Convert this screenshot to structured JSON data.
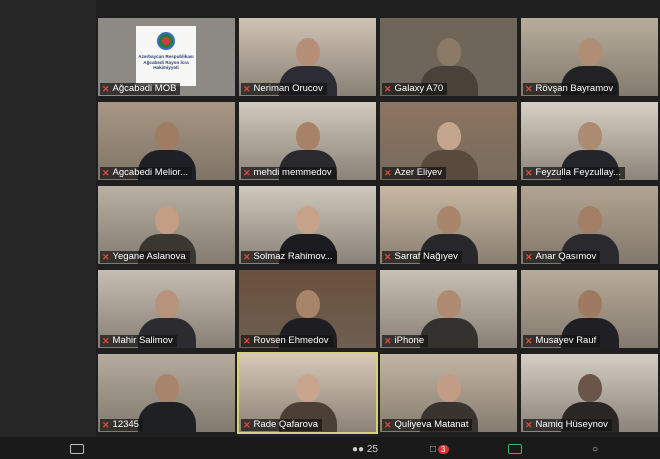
{
  "meeting": {
    "participant_count": "25",
    "toolbar_badge": "3",
    "participants": [
      {
        "name": "Ağcabədi MOB",
        "variant": "logo",
        "logo_text": "Azərbaycan Respublikası Ağcabədi Rayon İcra Hakimiyyəti"
      },
      {
        "name": "Neriman Orucov",
        "bg": "#cfc3b4",
        "skin": "#b58f78",
        "cloth": "#2c2c34"
      },
      {
        "name": "Galaxy A70",
        "bg": "#6f6659",
        "skin": "#8d7a66",
        "cloth": "#4a4238"
      },
      {
        "name": "Rövşan Bayramov",
        "bg": "#b8ad9c",
        "skin": "#b08e76",
        "cloth": "#232326"
      },
      {
        "name": "Agcabedi Melior...",
        "bg": "#a89784",
        "skin": "#9f7c62",
        "cloth": "#1f2026"
      },
      {
        "name": "mehdi memmedov",
        "bg": "#d2cabc",
        "skin": "#a88268",
        "cloth": "#2a2a2e"
      },
      {
        "name": "Azer Eliyev",
        "bg": "#8d7560",
        "skin": "#c4a58e",
        "cloth": "#5a4a3e"
      },
      {
        "name": "Feyzulla Feyzullay...",
        "bg": "#d8d0c4",
        "skin": "#ad8a72",
        "cloth": "#24252b"
      },
      {
        "name": "Yegane Aslanova",
        "bg": "#b9b0a3",
        "skin": "#c39d84",
        "cloth": "#3a3630"
      },
      {
        "name": "Solmaz Rahimov...",
        "bg": "#cfc8bd",
        "skin": "#c7a28a",
        "cloth": "#1c1c20"
      },
      {
        "name": "Sarraf Nağıyev",
        "bg": "#c9b9a3",
        "skin": "#a9856b",
        "cloth": "#28282c"
      },
      {
        "name": "Anar Qasımov",
        "bg": "#b2a491",
        "skin": "#a27f66",
        "cloth": "#2a2a2e"
      },
      {
        "name": "Mahir Salimov",
        "bg": "#c6beb2",
        "skin": "#b7937b",
        "cloth": "#2b2b30"
      },
      {
        "name": "Rovsen Ehmedov",
        "bg": "#6b4f3b",
        "skin": "#a8846b",
        "cloth": "#1e1e22"
      },
      {
        "name": "iPhone",
        "bg": "#c8c0b3",
        "skin": "#ae8a70",
        "cloth": "#34322e"
      },
      {
        "name": "Musayev Rauf",
        "bg": "#b7ab9a",
        "skin": "#9e7a62",
        "cloth": "#202024"
      },
      {
        "name": "12345",
        "bg": "#b5ab9e",
        "skin": "#a8846c",
        "cloth": "#1f2024"
      },
      {
        "name": "Rade Qafarova",
        "bg": "#d7c8b8",
        "skin": "#caa58d",
        "cloth": "#4b3f36",
        "active": true
      },
      {
        "name": "Quliyeva Matanat",
        "bg": "#c2b5a2",
        "skin": "#c29c84",
        "cloth": "#3a3430"
      },
      {
        "name": "Namiq Hüseynov",
        "bg": "#d3cdc4",
        "skin": "#6b5548",
        "cloth": "#2a2624"
      }
    ]
  }
}
